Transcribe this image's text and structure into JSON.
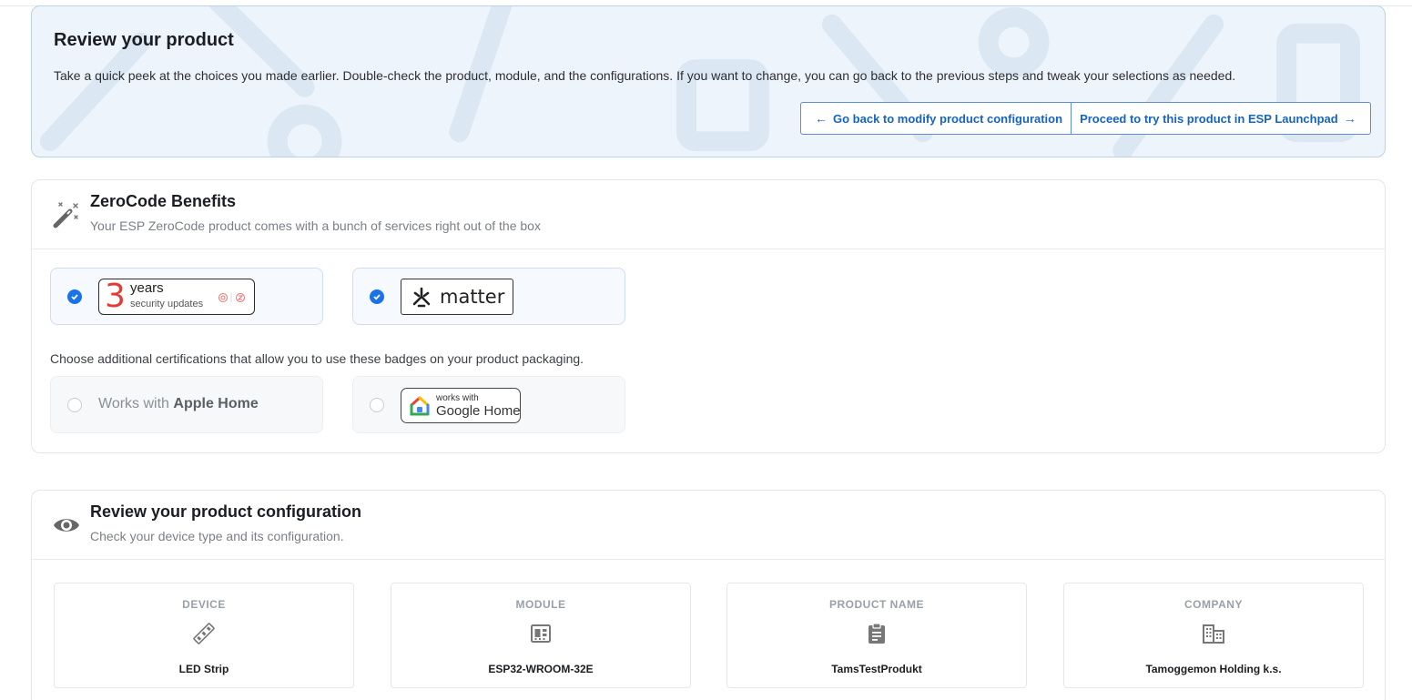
{
  "review": {
    "title": "Review your product",
    "description": "Take a quick peek at the choices you made earlier. Double-check the product, module, and the configurations. If you want to change, you can go back to the previous steps and tweak your selections as needed.",
    "back_button": "Go back to modify product configuration",
    "proceed_button": "Proceed to try this product in ESP Launchpad"
  },
  "benefits": {
    "title": "ZeroCode Benefits",
    "subtitle": "Your ESP ZeroCode product comes with a bunch of services right out of the box",
    "security_badge": {
      "number": "3",
      "word": "years",
      "sub": "security updates",
      "checked": true
    },
    "matter_badge": {
      "text": "matter",
      "checked": true
    },
    "certifications_text": "Choose additional certifications that allow you to use these badges on your product packaging.",
    "apple": {
      "prefix": "Works with",
      "name": "Apple Home",
      "checked": false
    },
    "google": {
      "small": "works with",
      "big": "Google Home",
      "checked": false
    }
  },
  "config": {
    "title": "Review your product configuration",
    "subtitle": "Check your device type and its configuration.",
    "tiles": [
      {
        "label": "DEVICE",
        "value": "LED Strip",
        "icon": "led-strip-icon"
      },
      {
        "label": "MODULE",
        "value": "ESP32-WROOM-32E",
        "icon": "chip-module-icon"
      },
      {
        "label": "PRODUCT NAME",
        "value": "TamsTestProdukt",
        "icon": "clipboard-icon"
      },
      {
        "label": "COMPANY",
        "value": "Tamoggemon Holding k.s.",
        "icon": "building-icon"
      }
    ]
  },
  "colors": {
    "accent": "#1565c0",
    "checkbox": "#1a73e8",
    "security_red": "#e53935"
  }
}
